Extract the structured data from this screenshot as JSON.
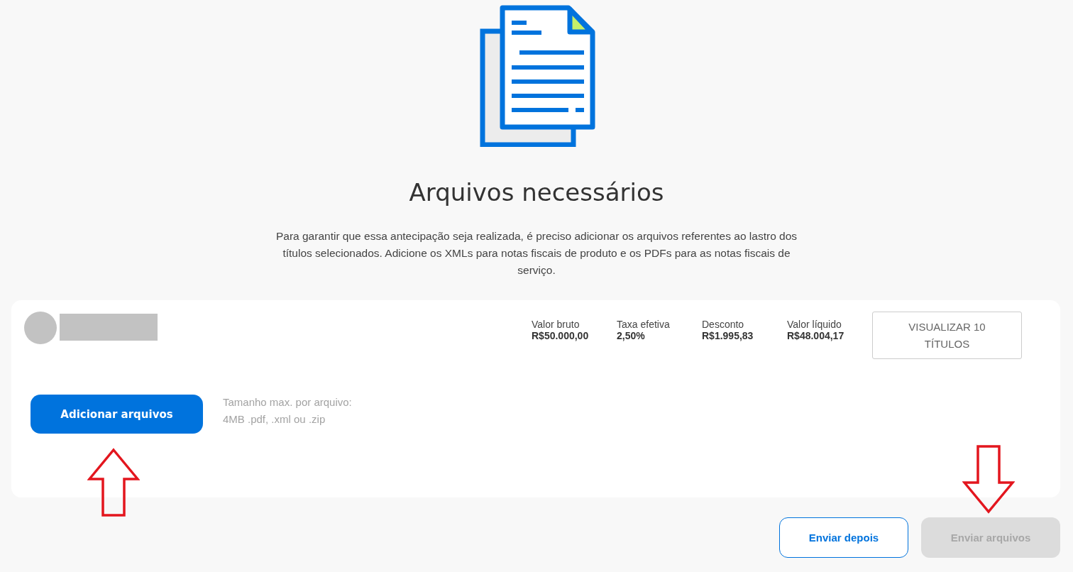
{
  "header": {
    "title": "Arquivos necessários",
    "description": "Para garantir que essa antecipação seja realizada, é preciso adicionar os arquivos referentes ao lastro dos títulos selecionados. Adicione os XMLs para notas fiscais de produto e os PDFs para as notas fiscais de serviço."
  },
  "card": {
    "summary": [
      {
        "label": "Valor bruto",
        "value": "R$50.000,00"
      },
      {
        "label": "Taxa efetiva",
        "value": "2,50%"
      },
      {
        "label": "Desconto",
        "value": "R$1.995,83"
      },
      {
        "label": "Valor líquido",
        "value": "R$48.004,17"
      }
    ],
    "view_button": "VISUALIZAR 10 TÍTULOS",
    "upload_button": "Adicionar arquivos",
    "upload_hint": [
      "Tamanho max. por arquivo:",
      "4MB .pdf, .xml ou .zip"
    ]
  },
  "actions": [
    {
      "label": "Enviar depois",
      "kind": "outline",
      "disabled": false
    },
    {
      "label": "Enviar arquivos",
      "kind": "filled",
      "disabled": true
    }
  ],
  "annotations": [
    {
      "kind": "up"
    },
    {
      "kind": "down"
    }
  ]
}
